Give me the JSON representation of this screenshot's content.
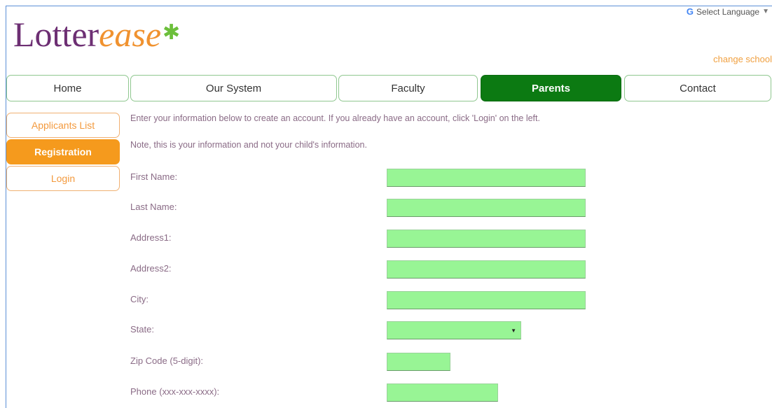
{
  "brand": {
    "part1": "Lotter",
    "part2": "ease",
    "star": "✱"
  },
  "language": {
    "icon": "google-g-icon",
    "label": "Select Language",
    "caret": "▼"
  },
  "change_school": "change school",
  "nav": [
    "Home",
    "Our System",
    "Faculty",
    "Parents",
    "Contact"
  ],
  "nav_active": "Parents",
  "sidebar": [
    "Applicants List",
    "Registration",
    "Login"
  ],
  "sidebar_active": "Registration",
  "intro": [
    "Enter your information below to create an account. If you already have an account, click 'Login' on the left.",
    "Note, this is your information and not your child's information."
  ],
  "form": {
    "first_name": "First Name:",
    "last_name": "Last Name:",
    "address1": "Address1:",
    "address2": "Address2:",
    "city": "City:",
    "state": "State:",
    "zip": "Zip Code (5-digit):",
    "phone": "Phone (xxx-xxx-xxxx):"
  },
  "colors": {
    "brand_purple": "#6d2f73",
    "brand_orange": "#f0922f",
    "nav_active": "#0c7a12",
    "sidebar_active": "#f59a1d",
    "field_bg": "#98f595"
  }
}
